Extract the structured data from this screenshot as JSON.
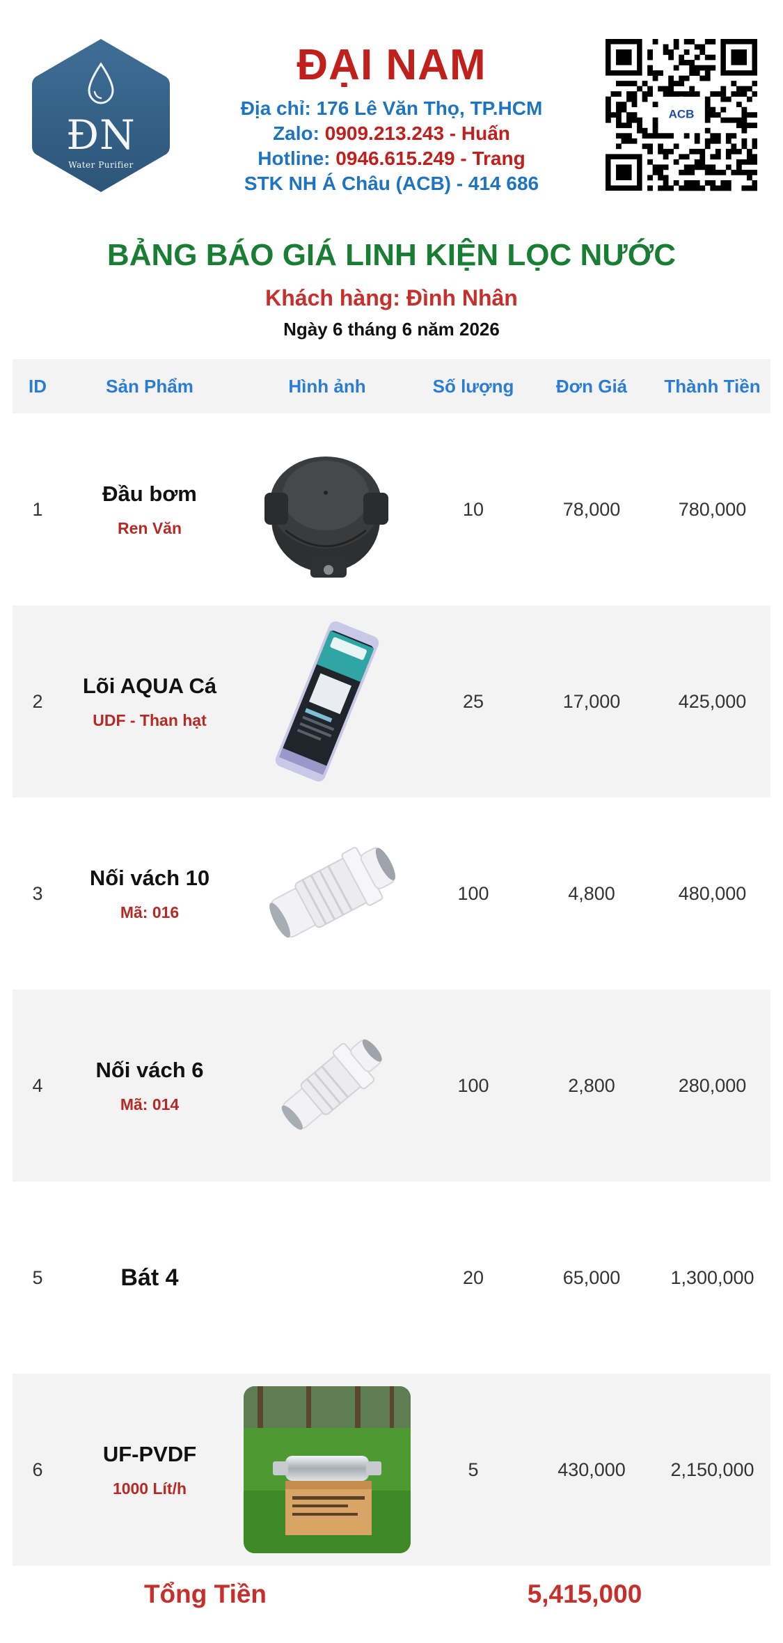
{
  "company": {
    "logo_monogram": "ĐN",
    "logo_tagline": "Water Purifier",
    "name": "ĐẠI NAM",
    "address_label": "Địa chỉ: 176 Lê Văn Thọ, TP.HCM",
    "zalo_label": "Zalo: ",
    "zalo_value": "0909.213.243 - Huấn",
    "hotline_label": "Hotline: ",
    "hotline_value": "0946.615.249 - Trang",
    "bank": "STK NH Á Châu (ACB) - 414 686",
    "qr_badge": "ACB"
  },
  "quote": {
    "title": "BẢNG BÁO GIÁ LINH KIỆN LỌC NƯỚC",
    "customer": "Khách hàng: Đình Nhân",
    "date": "Ngày 6 tháng 6 năm 2026"
  },
  "table": {
    "headers": [
      "ID",
      "Sản Phẩm",
      "Hình ảnh",
      "Số lượng",
      "Đơn Giá",
      "Thành Tiền"
    ],
    "rows": [
      {
        "id": "1",
        "name": "Đầu bơm",
        "sub": "Ren Văn",
        "image": "pump-head-image",
        "qty": "10",
        "price": "78,000",
        "total": "780,000"
      },
      {
        "id": "2",
        "name": "Lõi AQUA Cá",
        "sub": "UDF - Than hạt",
        "image": "aqua-carbon-filter-image",
        "qty": "25",
        "price": "17,000",
        "total": "425,000"
      },
      {
        "id": "3",
        "name": "Nối vách 10",
        "sub": "Mã: 016",
        "image": "bulkhead-fitting-10-image",
        "qty": "100",
        "price": "4,800",
        "total": "480,000"
      },
      {
        "id": "4",
        "name": "Nối vách 6",
        "sub": "Mã: 014",
        "image": "bulkhead-fitting-6-image",
        "qty": "100",
        "price": "2,800",
        "total": "280,000"
      },
      {
        "id": "5",
        "name": "Bát 4",
        "sub": "",
        "image": "",
        "qty": "20",
        "price": "65,000",
        "total": "1,300,000"
      },
      {
        "id": "6",
        "name": "UF-PVDF",
        "sub": "1000 Lít/h",
        "image": "uf-pvdf-filter-image",
        "qty": "5",
        "price": "430,000",
        "total": "2,150,000"
      }
    ]
  },
  "summary": {
    "total_label": "Tổng Tiền",
    "total_value": "5,415,000"
  },
  "colors": {
    "brand_red": "#c0201c",
    "info_blue": "#1f74c0",
    "title_green": "#1a7d34",
    "header_blue": "#2c7dd1",
    "row_alt": "#f3f3f3"
  }
}
